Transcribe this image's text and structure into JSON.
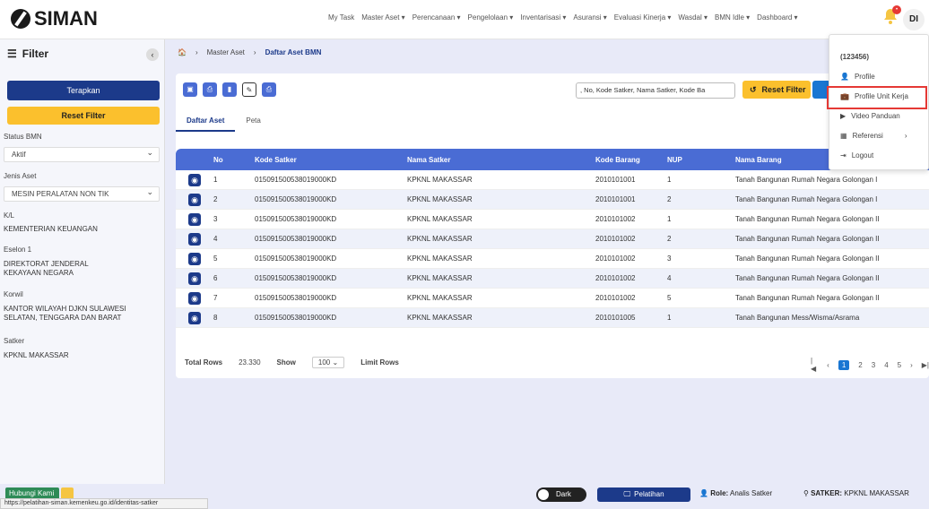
{
  "app": {
    "name": "SIMAN"
  },
  "topnav": [
    "My Task",
    "Master Aset ▾",
    "Perencanaan ▾",
    "Pengelolaan ▾",
    "Inventarisasi ▾",
    "Asuransi ▾",
    "Evaluasi Kinerja ▾",
    "Wasdal ▾",
    "BMN Idle ▾",
    "Dashboard ▾"
  ],
  "user": {
    "initials": "DI",
    "notification_count": "•"
  },
  "dropdown": {
    "id": "(123456)",
    "items": [
      "Profile",
      "Profile Unit Kerja",
      "Video Panduan",
      "Referensi",
      "Logout"
    ]
  },
  "sidebar": {
    "title": "Filter",
    "apply": "Terapkan",
    "reset": "Reset Filter",
    "status_label": "Status BMN",
    "status_value": "Aktif",
    "jenis_label": "Jenis Aset",
    "jenis_value": "MESIN PERALATAN NON TIK",
    "kl_label": "K/L",
    "kl_value": "KEMENTERIAN KEUANGAN",
    "eselon_label": "Eselon 1",
    "eselon_value": "DIREKTORAT JENDERAL KEKAYAAN NEGARA",
    "korwil_label": "Korwil",
    "korwil_value": "KANTOR WILAYAH DJKN SULAWESI SELATAN, TENGGARA DAN BARAT",
    "satker_label": "Satker",
    "satker_value": "KPKNL MAKASSAR"
  },
  "breadcrumb": {
    "home": "🏠",
    "level1": "Master Aset",
    "level2": "Daftar Aset BMN"
  },
  "search": {
    "value": ", No, Kode Satker, Nama Satker, Kode Ba"
  },
  "reset_filter": "Reset Filter",
  "tabs": [
    "Daftar Aset",
    "Peta"
  ],
  "table": {
    "headers": [
      "",
      "No",
      "Kode Satker",
      "Nama Satker",
      "Kode Barang",
      "NUP",
      "Nama Barang"
    ],
    "rows": [
      [
        "1",
        "015091500538019000KD",
        "KPKNL MAKASSAR",
        "2010101001",
        "1",
        "Tanah Bangunan Rumah Negara Golongan I"
      ],
      [
        "2",
        "015091500538019000KD",
        "KPKNL MAKASSAR",
        "2010101001",
        "2",
        "Tanah Bangunan Rumah Negara Golongan I"
      ],
      [
        "3",
        "015091500538019000KD",
        "KPKNL MAKASSAR",
        "2010101002",
        "1",
        "Tanah Bangunan Rumah Negara Golongan II"
      ],
      [
        "4",
        "015091500538019000KD",
        "KPKNL MAKASSAR",
        "2010101002",
        "2",
        "Tanah Bangunan Rumah Negara Golongan II"
      ],
      [
        "5",
        "015091500538019000KD",
        "KPKNL MAKASSAR",
        "2010101002",
        "3",
        "Tanah Bangunan Rumah Negara Golongan II"
      ],
      [
        "6",
        "015091500538019000KD",
        "KPKNL MAKASSAR",
        "2010101002",
        "4",
        "Tanah Bangunan Rumah Negara Golongan II"
      ],
      [
        "7",
        "015091500538019000KD",
        "KPKNL MAKASSAR",
        "2010101002",
        "5",
        "Tanah Bangunan Rumah Negara Golongan II"
      ],
      [
        "8",
        "015091500538019000KD",
        "KPKNL MAKASSAR",
        "2010101005",
        "1",
        "Tanah Bangunan Mess/Wisma/Asrama"
      ]
    ]
  },
  "footer": {
    "total_label": "Total Rows",
    "total_value": "23.330",
    "show_label": "Show",
    "show_value": "100",
    "limit_label": "Limit Rows"
  },
  "pager": [
    "|◀",
    "‹",
    "1",
    "2",
    "3",
    "4",
    "5",
    "›",
    "▶|"
  ],
  "bottom": {
    "contact": "Hubungi Kami",
    "dark": "Dark",
    "pelatihan": "Pelatihan",
    "role_label": "Role:",
    "role_value": "Analis Satker",
    "satker_label": "SATKER:",
    "satker_value": "KPKNL MAKASSAR",
    "url": "https://pelatihan-siman.kemenkeu.go.id/identitas-satker"
  }
}
